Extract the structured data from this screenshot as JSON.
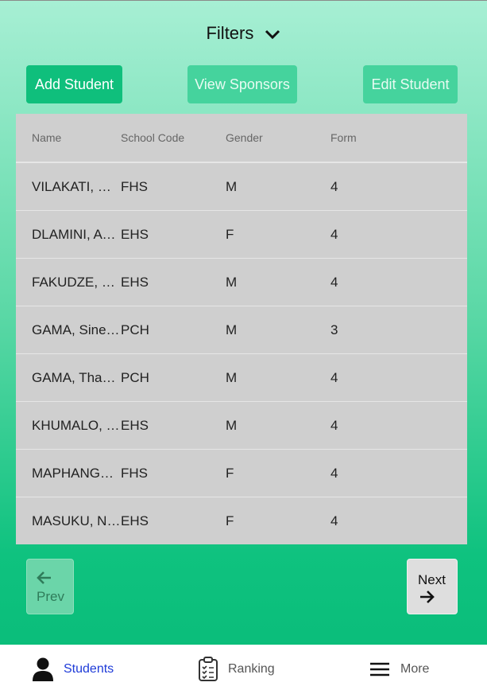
{
  "header": {
    "filters_label": "Filters"
  },
  "toolbar": {
    "add_label": "Add Student",
    "sponsors_label": "View Sponsors",
    "edit_label": "Edit Student"
  },
  "table": {
    "columns": [
      "Name",
      "School Code",
      "Gender",
      "Form"
    ],
    "rows": [
      {
        "name": "VILAKATI, Ncedo",
        "school": "FHS",
        "gender": "M",
        "form": "4"
      },
      {
        "name": "DLAMINI, Ayanda",
        "school": "EHS",
        "gender": "F",
        "form": "4"
      },
      {
        "name": "FAKUDZE, Sibonelo",
        "school": "EHS",
        "gender": "M",
        "form": "4"
      },
      {
        "name": "GAMA, Sinethemba",
        "school": "PCH",
        "gender": "M",
        "form": "3"
      },
      {
        "name": "GAMA, Thando",
        "school": "PCH",
        "gender": "M",
        "form": "4"
      },
      {
        "name": "KHUMALO, Mzwandile",
        "school": "EHS",
        "gender": "M",
        "form": "4"
      },
      {
        "name": "MAPHANGA, Bongani",
        "school": "FHS",
        "gender": "F",
        "form": "4"
      },
      {
        "name": "MASUKU, Nolwazi",
        "school": "EHS",
        "gender": "F",
        "form": "4"
      }
    ]
  },
  "pager": {
    "prev_label": "Prev",
    "next_label": "Next"
  },
  "nav": {
    "students": "Students",
    "ranking": "Ranking",
    "more": "More"
  },
  "colors": {
    "active": "#1e3bd8",
    "inactive": "#555555",
    "accent": "#0fbf7c"
  }
}
